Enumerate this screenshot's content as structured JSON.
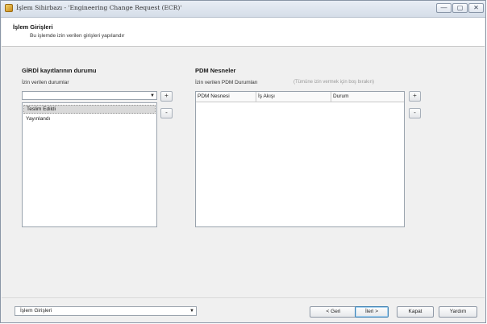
{
  "window": {
    "title": "İşlem Sihirbazı - 'Engineering Change Request (ECR)'",
    "controls": {
      "minimize": "—",
      "maximize": "▢",
      "close": "✕"
    }
  },
  "header": {
    "title": "İşlem Girişleri",
    "subtitle": "Bu işlemde izin verilen girişleri yapılandır"
  },
  "left": {
    "title": "GİRDİ kayıtlarının durumu",
    "allowed_label": "İzin verilen durumlar",
    "combo_value": "",
    "add_label": "+",
    "remove_label": "-",
    "items": [
      {
        "label": "Teslim Edildi",
        "selected": true
      },
      {
        "label": "Yayınlandı",
        "selected": false
      }
    ]
  },
  "right": {
    "title": "PDM Nesneler",
    "allowed_label": "İzin verilen PDM Durumları",
    "hint": "(Tümüne izin vermek için boş bırakın)",
    "columns": [
      "PDM Nesnesi",
      "İş Akışı",
      "Durum"
    ],
    "add_label": "+",
    "remove_label": "-"
  },
  "footer": {
    "step_select": "İşlem Girişleri",
    "back": "< Geri",
    "next": "İleri >",
    "close": "Kapat",
    "help": "Yardım"
  }
}
